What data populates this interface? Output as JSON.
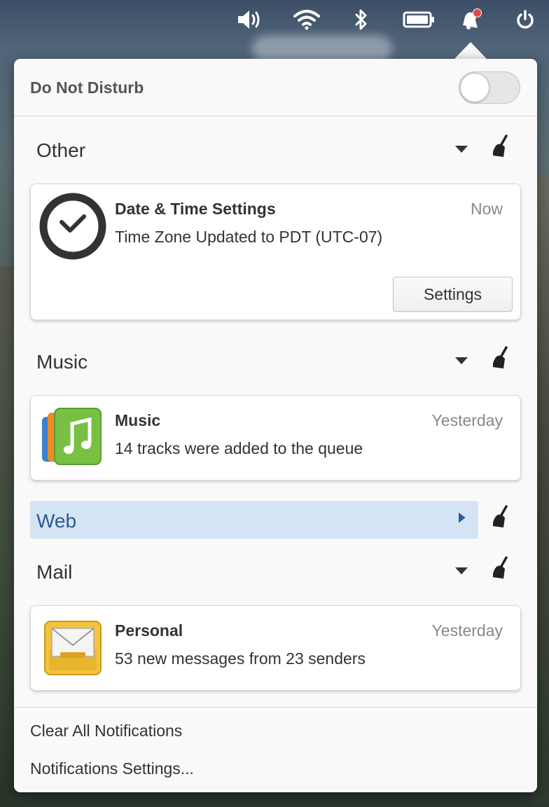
{
  "panel": {
    "icons": [
      "volume-icon",
      "wifi-icon",
      "bluetooth-icon",
      "battery-icon",
      "notifications-icon",
      "power-icon"
    ],
    "notification_dot_color": "#e24b4b"
  },
  "dnd": {
    "label": "Do Not Disturb",
    "enabled": false
  },
  "groups": [
    {
      "title": "Other",
      "expanded": true,
      "notifications": [
        {
          "icon": "clock-icon",
          "title": "Date & Time Settings",
          "time": "Now",
          "body": "Time Zone Updated to PDT (UTC-07)",
          "action": "Settings"
        }
      ]
    },
    {
      "title": "Music",
      "expanded": true,
      "notifications": [
        {
          "icon": "music-app-icon",
          "title": "Music",
          "time": "Yesterday",
          "body": "14 tracks were added to the queue"
        }
      ]
    },
    {
      "title": "Web",
      "expanded": false,
      "selected": true,
      "notifications": []
    },
    {
      "title": "Mail",
      "expanded": true,
      "notifications": [
        {
          "icon": "mail-app-icon",
          "title": "Personal",
          "time": "Yesterday",
          "body": "53 new messages from 23 senders"
        }
      ]
    }
  ],
  "footer": {
    "clear_all": "Clear All Notifications",
    "settings": "Notifications Settings..."
  },
  "colors": {
    "popover_bg": "#f9f9f9",
    "selected_group_bg": "#d5e4f5",
    "selected_group_text": "#2a5a93"
  }
}
